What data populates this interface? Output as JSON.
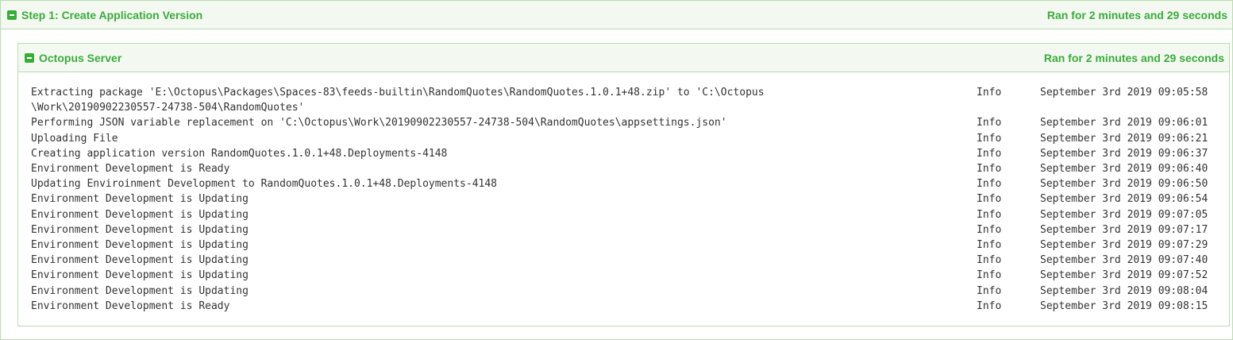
{
  "step": {
    "title": "Step 1: Create Application Version",
    "duration": "Ran for 2 minutes and 29 seconds"
  },
  "server": {
    "title": "Octopus Server",
    "duration": "Ran for 2 minutes and 29 seconds"
  },
  "log": [
    {
      "message": "Extracting package 'E:\\Octopus\\Packages\\Spaces-83\\feeds-builtin\\RandomQuotes\\RandomQuotes.1.0.1+48.zip' to 'C:\\Octopus\n\\Work\\20190902230557-24738-504\\RandomQuotes'",
      "category": "Info",
      "time": "September 3rd 2019 09:05:58"
    },
    {
      "message": "Performing JSON variable replacement on 'C:\\Octopus\\Work\\20190902230557-24738-504\\RandomQuotes\\appsettings.json'",
      "category": "Info",
      "time": "September 3rd 2019 09:06:01"
    },
    {
      "message": "Uploading File",
      "category": "Info",
      "time": "September 3rd 2019 09:06:21"
    },
    {
      "message": "Creating application version RandomQuotes.1.0.1+48.Deployments-4148",
      "category": "Info",
      "time": "September 3rd 2019 09:06:37"
    },
    {
      "message": "Environment Development is Ready",
      "category": "Info",
      "time": "September 3rd 2019 09:06:40"
    },
    {
      "message": "Updating Enviroinment Development to RandomQuotes.1.0.1+48.Deployments-4148",
      "category": "Info",
      "time": "September 3rd 2019 09:06:50"
    },
    {
      "message": "Environment Development is Updating",
      "category": "Info",
      "time": "September 3rd 2019 09:06:54"
    },
    {
      "message": "Environment Development is Updating",
      "category": "Info",
      "time": "September 3rd 2019 09:07:05"
    },
    {
      "message": "Environment Development is Updating",
      "category": "Info",
      "time": "September 3rd 2019 09:07:17"
    },
    {
      "message": "Environment Development is Updating",
      "category": "Info",
      "time": "September 3rd 2019 09:07:29"
    },
    {
      "message": "Environment Development is Updating",
      "category": "Info",
      "time": "September 3rd 2019 09:07:40"
    },
    {
      "message": "Environment Development is Updating",
      "category": "Info",
      "time": "September 3rd 2019 09:07:52"
    },
    {
      "message": "Environment Development is Updating",
      "category": "Info",
      "time": "September 3rd 2019 09:08:04"
    },
    {
      "message": "Environment Development is Ready",
      "category": "Info",
      "time": "September 3rd 2019 09:08:15"
    }
  ]
}
